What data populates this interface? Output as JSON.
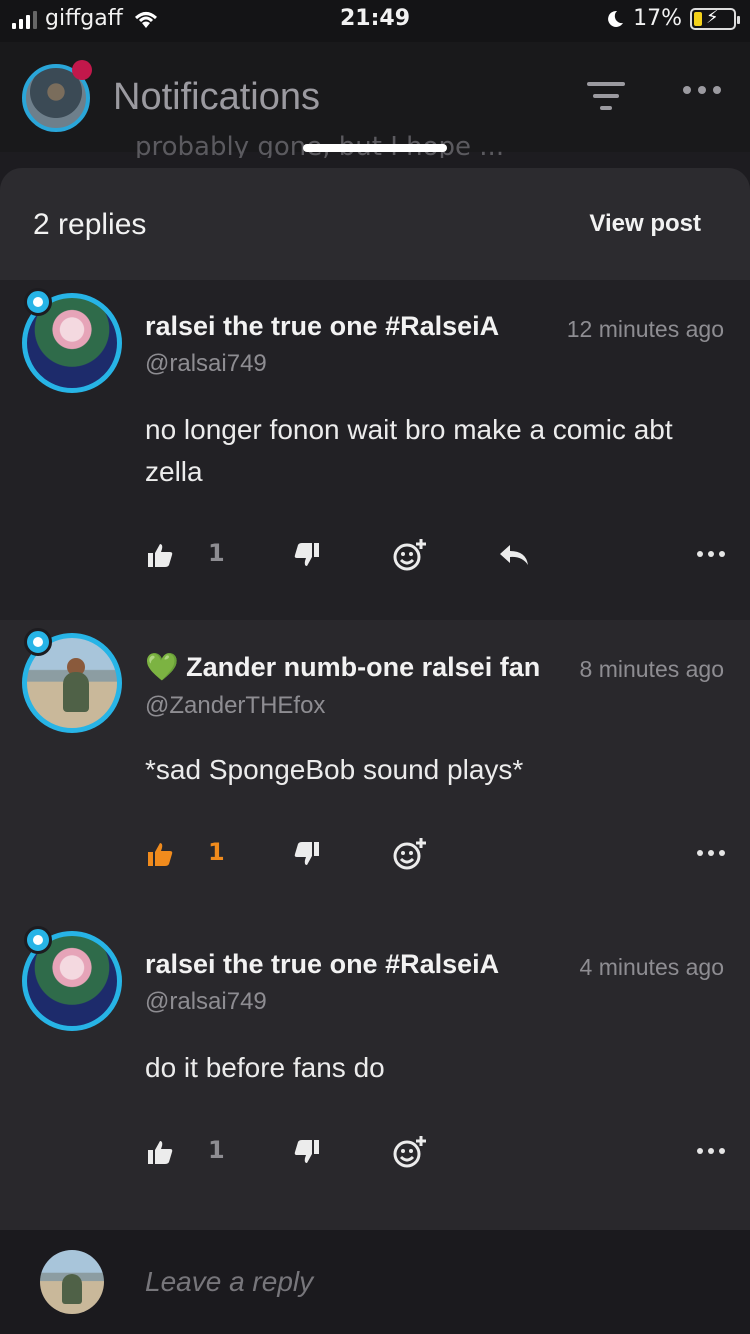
{
  "status_bar": {
    "carrier": "giffgaff",
    "time": "21:49",
    "battery": "17%"
  },
  "nav": {
    "title": "Notifications",
    "peek_text": "probably gone, but I hope ..."
  },
  "sheet": {
    "reply_count": "2 replies",
    "view_post": "View post"
  },
  "comments": [
    {
      "name": "ralsei the true one #RalseiA",
      "handle": "@ralsai749",
      "ago": "12 minutes ago",
      "body": "no longer fonon wait bro make a comic abt zella",
      "likes": "1",
      "liked": false
    },
    {
      "emoji": "💚",
      "name": "Zander numb-one ralsei fan",
      "handle": "@ZanderTHEfox",
      "ago": "8 minutes ago",
      "body": "*sad SpongeBob sound plays*",
      "likes": "1",
      "liked": true
    },
    {
      "name": "ralsei the true one #RalseiA",
      "handle": "@ralsai749",
      "ago": "4 minutes ago",
      "body": "do it before fans do",
      "likes": "1",
      "liked": false
    }
  ],
  "reply_bar": {
    "placeholder": "Leave a reply"
  },
  "colors": {
    "accent_orange": "#f08b1d",
    "avatar_ring": "#27b4e6",
    "notification_dot": "#c2184b"
  }
}
